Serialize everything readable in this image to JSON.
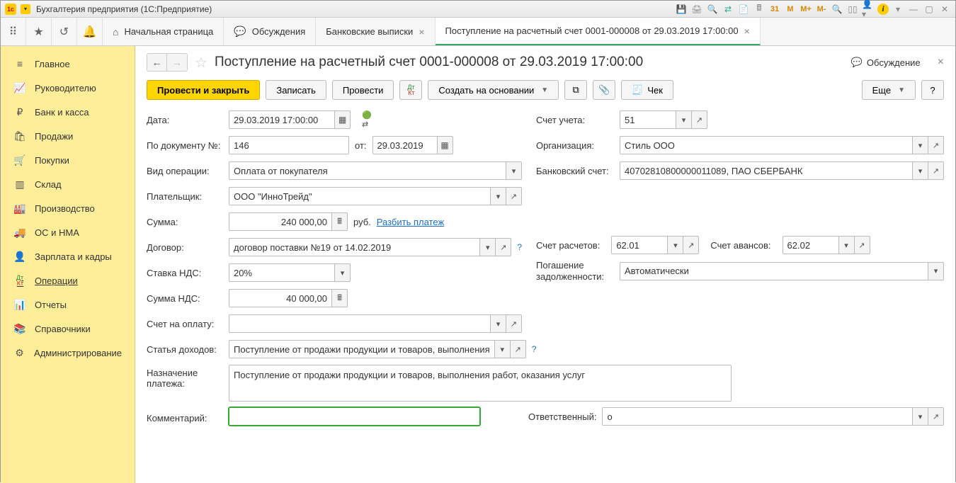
{
  "window": {
    "title": "Бухгалтерия предприятия  (1С:Предприятие)"
  },
  "sys_icons": {
    "m": "M",
    "mplus": "M+",
    "mminus": "M-"
  },
  "tabs": {
    "home": "Начальная страница",
    "discuss": "Обсуждения",
    "bank": "Банковские выписки",
    "doc": "Поступление на расчетный счет 0001-000008 от 29.03.2019 17:00:00"
  },
  "sidebar": {
    "items": [
      {
        "label": "Главное"
      },
      {
        "label": "Руководителю"
      },
      {
        "label": "Банк и касса"
      },
      {
        "label": "Продажи"
      },
      {
        "label": "Покупки"
      },
      {
        "label": "Склад"
      },
      {
        "label": "Производство"
      },
      {
        "label": "ОС и НМА"
      },
      {
        "label": "Зарплата и кадры"
      },
      {
        "label": "Операции"
      },
      {
        "label": "Отчеты"
      },
      {
        "label": "Справочники"
      },
      {
        "label": "Администрирование"
      }
    ]
  },
  "doc": {
    "title": "Поступление на расчетный счет 0001-000008 от 29.03.2019 17:00:00",
    "discuss_label": "Обсуждение"
  },
  "toolbar": {
    "post_close": "Провести и закрыть",
    "save": "Записать",
    "post": "Провести",
    "create_based": "Создать на основании",
    "cheque": "Чек",
    "more": "Еще",
    "help": "?"
  },
  "labels": {
    "date": "Дата:",
    "doc_no": "По документу №:",
    "from": "от:",
    "op_type": "Вид операции:",
    "payer": "Плательщик:",
    "sum": "Сумма:",
    "rub": "руб.",
    "split": "Разбить платеж",
    "contract": "Договор:",
    "vat_rate": "Ставка НДС:",
    "vat_sum": "Сумма НДС:",
    "invoice": "Счет на оплату:",
    "income_item": "Статья доходов:",
    "purpose": "Назначение платежа:",
    "comment": "Комментарий:",
    "account": "Счет учета:",
    "org": "Организация:",
    "bank_acct": "Банковский счет:",
    "settle_acct": "Счет расчетов:",
    "advance_acct": "Счет авансов:",
    "debt_repay": "Погашение задолженности:",
    "responsible": "Ответственный:"
  },
  "values": {
    "date": "29.03.2019 17:00:00",
    "doc_no": "146",
    "doc_from": "29.03.2019",
    "op_type": "Оплата от покупателя",
    "payer": "ООО \"ИнноТрейд\"",
    "sum": "240 000,00",
    "contract": "договор поставки №19 от 14.02.2019",
    "vat_rate": "20%",
    "vat_sum": "40 000,00",
    "invoice": "",
    "income_item": "Поступление от продажи продукции и товаров, выполнения",
    "purpose": "Поступление от продажи продукции и товаров, выполнения работ, оказания услуг",
    "comment": "",
    "account": "51",
    "org": "Стиль ООО",
    "bank_acct": "40702810800000011089, ПАО СБЕРБАНК",
    "settle_acct": "62.01",
    "advance_acct": "62.02",
    "debt_repay": "Автоматически",
    "responsible": "о"
  }
}
